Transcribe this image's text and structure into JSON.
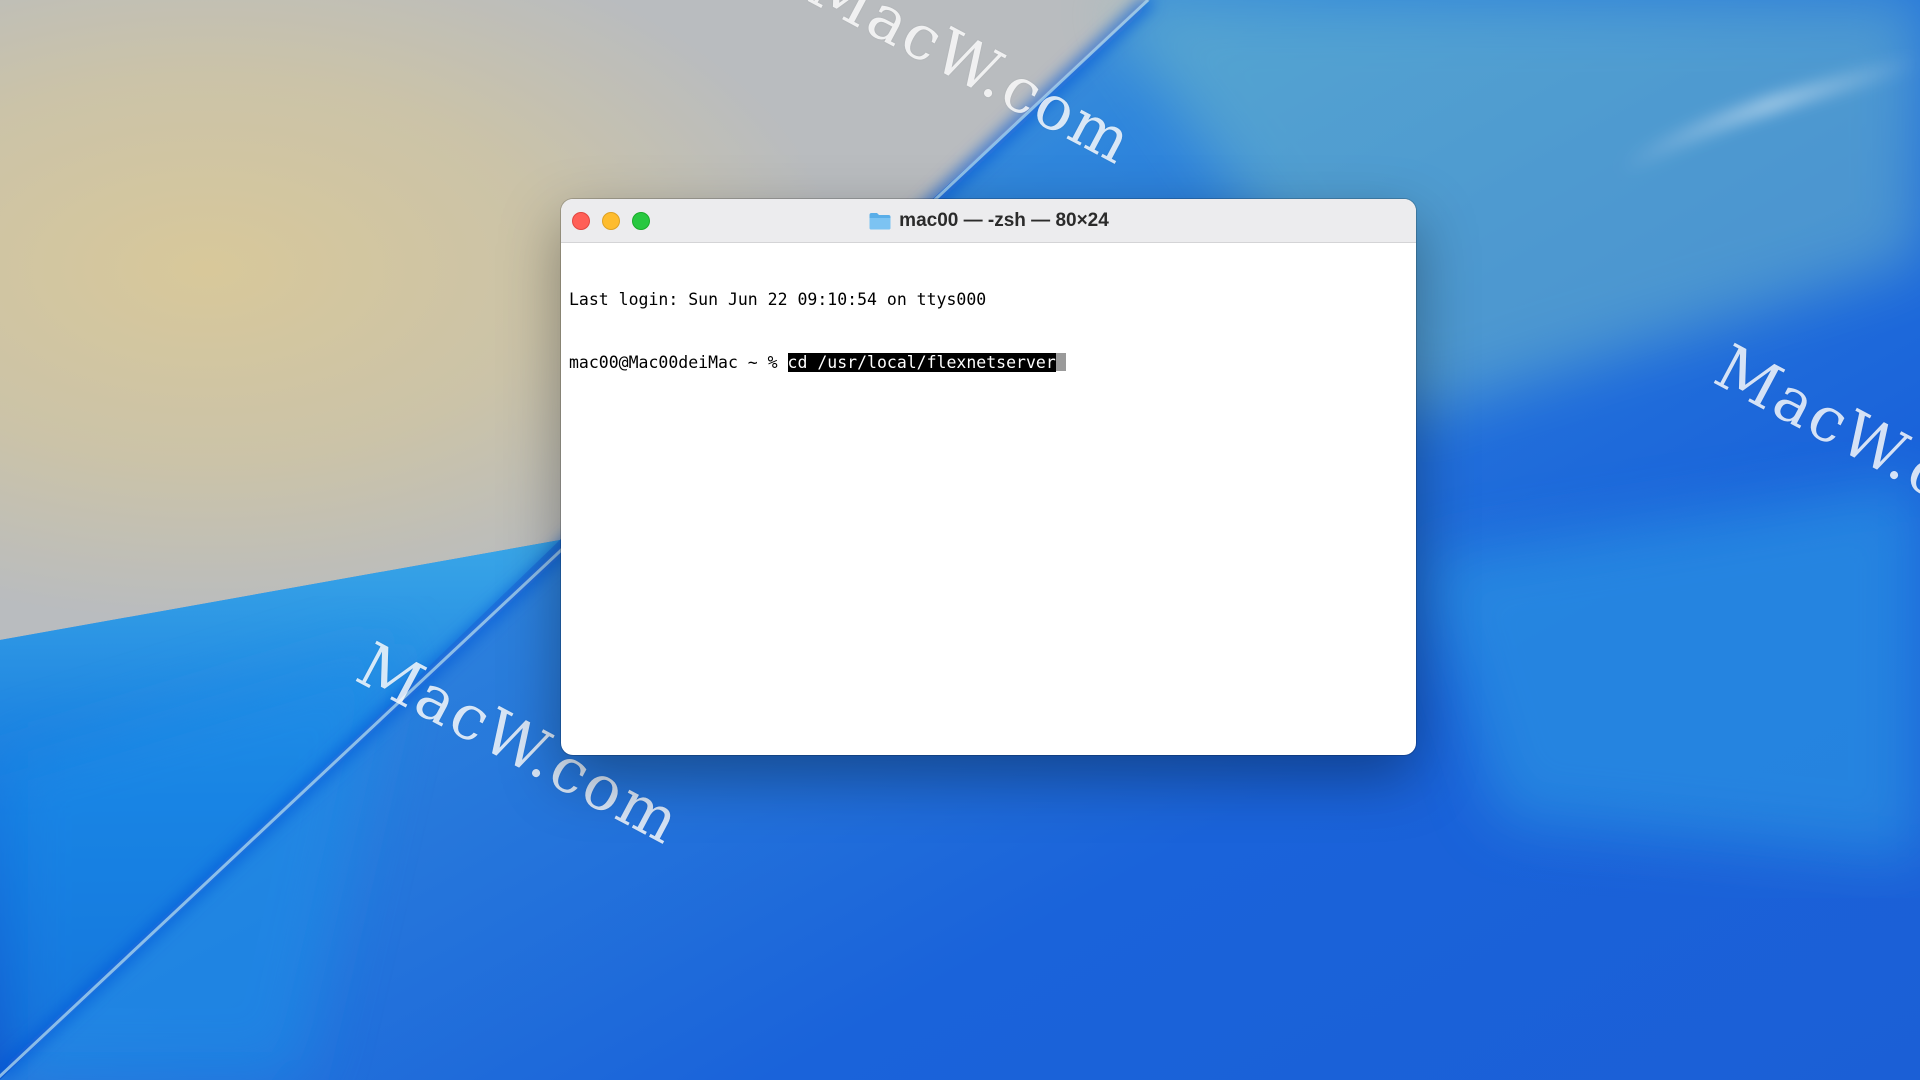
{
  "desktop": {
    "watermark_text": "MacW.com"
  },
  "terminal": {
    "title": "mac00 — -zsh — 80×24",
    "folder_icon": "folder-icon",
    "lines": {
      "last_login": "Last login: Sun Jun 22 09:10:54 on ttys000",
      "prompt": "mac00@Mac00deiMac ~ % ",
      "command": "cd /usr/local/flexnetserver"
    }
  },
  "colors": {
    "close": "#ff5f57",
    "minimize": "#febc2e",
    "zoom": "#28c840",
    "wallpaper_blue": "#1f6fe0"
  }
}
